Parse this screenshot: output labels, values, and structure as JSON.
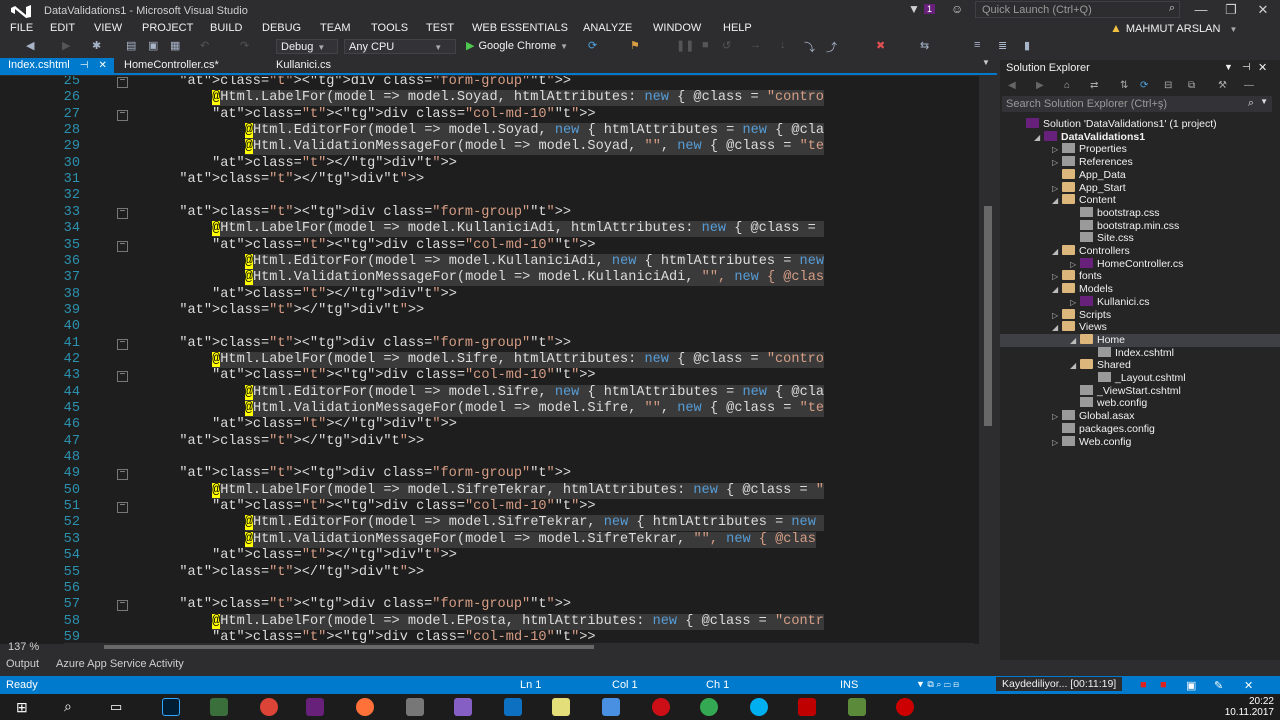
{
  "window": {
    "title": "DataValidations1 - Microsoft Visual Studio",
    "quick_launch_placeholder": "Quick Launch (Ctrl+Q)",
    "notification_count": "1",
    "user_name": "MAHMUT ARSLAN"
  },
  "menu": [
    "FILE",
    "EDIT",
    "VIEW",
    "PROJECT",
    "BUILD",
    "DEBUG",
    "TEAM",
    "TOOLS",
    "TEST",
    "WEB ESSENTIALS",
    "ANALYZE",
    "WINDOW",
    "HELP"
  ],
  "toolbar": {
    "configuration": "Debug",
    "platform": "Any CPU",
    "run_target": "Google Chrome"
  },
  "tabs": [
    {
      "label": "Index.cshtml",
      "active": true
    },
    {
      "label": "HomeController.cs*",
      "active": false
    },
    {
      "label": "Kullanici.cs",
      "active": false
    }
  ],
  "editor": {
    "zoom": "137 %",
    "lines": [
      {
        "n": "25",
        "text": "        <div class=\"form-group\">"
      },
      {
        "n": "26",
        "text": "            @Html.LabelFor(model => model.Soyad, htmlAttributes: new { @class = \"contro"
      },
      {
        "n": "27",
        "text": "            <div class=\"col-md-10\">"
      },
      {
        "n": "28",
        "text": "                @Html.EditorFor(model => model.Soyad, new { htmlAttributes = new { @cla"
      },
      {
        "n": "29",
        "text": "                @Html.ValidationMessageFor(model => model.Soyad, \"\", new { @class = \"te"
      },
      {
        "n": "30",
        "text": "            </div>"
      },
      {
        "n": "31",
        "text": "        </div>"
      },
      {
        "n": "32",
        "text": ""
      },
      {
        "n": "33",
        "text": "        <div class=\"form-group\">"
      },
      {
        "n": "34",
        "text": "            @Html.LabelFor(model => model.KullaniciAdi, htmlAttributes: new { @class = "
      },
      {
        "n": "35",
        "text": "            <div class=\"col-md-10\">"
      },
      {
        "n": "36",
        "text": "                @Html.EditorFor(model => model.KullaniciAdi, new { htmlAttributes = new"
      },
      {
        "n": "37",
        "text": "                @Html.ValidationMessageFor(model => model.KullaniciAdi, \"\", new { @clas"
      },
      {
        "n": "38",
        "text": "            </div>"
      },
      {
        "n": "39",
        "text": "        </div>"
      },
      {
        "n": "40",
        "text": ""
      },
      {
        "n": "41",
        "text": "        <div class=\"form-group\">"
      },
      {
        "n": "42",
        "text": "            @Html.LabelFor(model => model.Sifre, htmlAttributes: new { @class = \"contro"
      },
      {
        "n": "43",
        "text": "            <div class=\"col-md-10\">"
      },
      {
        "n": "44",
        "text": "                @Html.EditorFor(model => model.Sifre, new { htmlAttributes = new { @cla"
      },
      {
        "n": "45",
        "text": "                @Html.ValidationMessageFor(model => model.Sifre, \"\", new { @class = \"te"
      },
      {
        "n": "46",
        "text": "            </div>"
      },
      {
        "n": "47",
        "text": "        </div>"
      },
      {
        "n": "48",
        "text": ""
      },
      {
        "n": "49",
        "text": "        <div class=\"form-group\">"
      },
      {
        "n": "50",
        "text": "            @Html.LabelFor(model => model.SifreTekrar, htmlAttributes: new { @class = \""
      },
      {
        "n": "51",
        "text": "            <div class=\"col-md-10\">"
      },
      {
        "n": "52",
        "text": "                @Html.EditorFor(model => model.SifreTekrar, new { htmlAttributes = new "
      },
      {
        "n": "53",
        "text": "                @Html.ValidationMessageFor(model => model.SifreTekrar, \"\", new { @clas"
      },
      {
        "n": "54",
        "text": "            </div>"
      },
      {
        "n": "55",
        "text": "        </div>"
      },
      {
        "n": "56",
        "text": ""
      },
      {
        "n": "57",
        "text": "        <div class=\"form-group\">"
      },
      {
        "n": "58",
        "text": "            @Html.LabelFor(model => model.EPosta, htmlAttributes: new { @class = \"contr"
      },
      {
        "n": "59",
        "text": "            <div class=\"col-md-10\">"
      }
    ]
  },
  "solution_explorer": {
    "title": "Solution Explorer",
    "search_placeholder": "Search Solution Explorer (Ctrl+ş)",
    "items": [
      {
        "label": "Solution 'DataValidations1' (1 project)",
        "depth": 0,
        "icon": "solution"
      },
      {
        "label": "DataValidations1",
        "depth": 1,
        "icon": "project",
        "expand": "open"
      },
      {
        "label": "Properties",
        "depth": 2,
        "icon": "wrench",
        "expand": "closed"
      },
      {
        "label": "References",
        "depth": 2,
        "icon": "refs",
        "expand": "closed"
      },
      {
        "label": "App_Data",
        "depth": 2,
        "icon": "folder"
      },
      {
        "label": "App_Start",
        "depth": 2,
        "icon": "folder",
        "expand": "closed"
      },
      {
        "label": "Content",
        "depth": 2,
        "icon": "folder",
        "expand": "open"
      },
      {
        "label": "bootstrap.css",
        "depth": 3,
        "icon": "file"
      },
      {
        "label": "bootstrap.min.css",
        "depth": 3,
        "icon": "file"
      },
      {
        "label": "Site.css",
        "depth": 3,
        "icon": "file"
      },
      {
        "label": "Controllers",
        "depth": 2,
        "icon": "folder",
        "expand": "open"
      },
      {
        "label": "HomeController.cs",
        "depth": 3,
        "icon": "cs",
        "expand": "closed"
      },
      {
        "label": "fonts",
        "depth": 2,
        "icon": "folder",
        "expand": "closed"
      },
      {
        "label": "Models",
        "depth": 2,
        "icon": "folder",
        "expand": "open"
      },
      {
        "label": "Kullanici.cs",
        "depth": 3,
        "icon": "cs",
        "expand": "closed"
      },
      {
        "label": "Scripts",
        "depth": 2,
        "icon": "folder",
        "expand": "closed"
      },
      {
        "label": "Views",
        "depth": 2,
        "icon": "folder",
        "expand": "open"
      },
      {
        "label": "Home",
        "depth": 3,
        "icon": "folder",
        "expand": "open",
        "selected": true
      },
      {
        "label": "Index.cshtml",
        "depth": 4,
        "icon": "file"
      },
      {
        "label": "Shared",
        "depth": 3,
        "icon": "folder",
        "expand": "open"
      },
      {
        "label": "_Layout.cshtml",
        "depth": 4,
        "icon": "file"
      },
      {
        "label": "_ViewStart.cshtml",
        "depth": 3,
        "icon": "file"
      },
      {
        "label": "web.config",
        "depth": 3,
        "icon": "file"
      },
      {
        "label": "Global.asax",
        "depth": 2,
        "icon": "file",
        "expand": "closed"
      },
      {
        "label": "packages.config",
        "depth": 2,
        "icon": "file"
      },
      {
        "label": "Web.config",
        "depth": 2,
        "icon": "file",
        "expand": "closed"
      }
    ]
  },
  "bottom_tabs": [
    "Output",
    "Azure App Service Activity"
  ],
  "status": {
    "ready": "Ready",
    "ln": "Ln 1",
    "col": "Col 1",
    "ch": "Ch 1",
    "ins": "INS",
    "recording": "Kaydediliyor... [00:11:19]"
  },
  "clock": {
    "time": "20:22",
    "date": "10.11.2017"
  }
}
